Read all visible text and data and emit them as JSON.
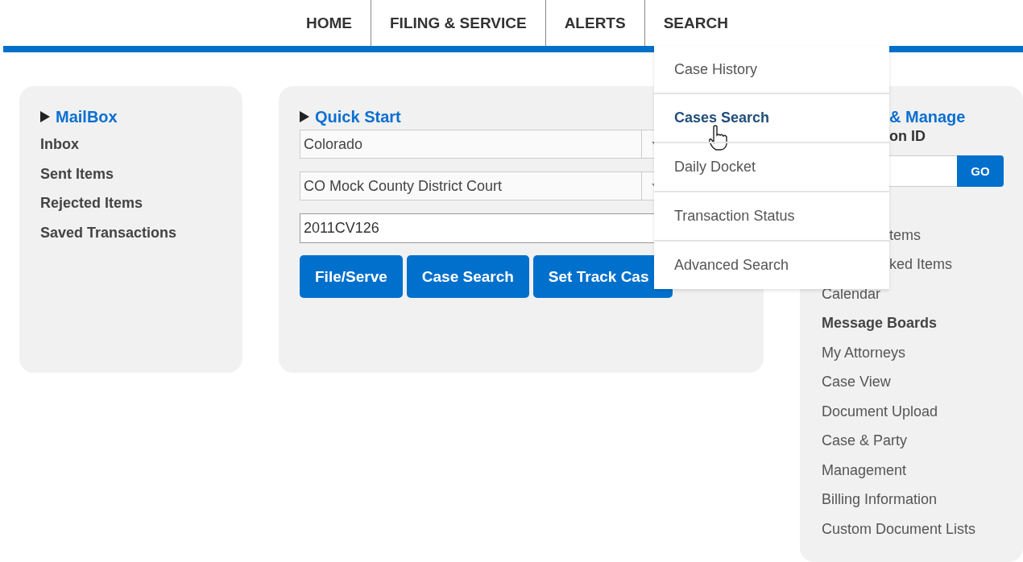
{
  "nav": {
    "tabs": [
      "HOME",
      "FILING & SERVICE",
      "ALERTS",
      "SEARCH"
    ]
  },
  "search_menu": {
    "items": [
      {
        "label": "Case History",
        "selected": false
      },
      {
        "label": "Cases Search",
        "selected": true
      },
      {
        "label": "Daily Docket",
        "selected": false
      },
      {
        "label": "Transaction Status",
        "selected": false
      },
      {
        "label": "Advanced Search",
        "selected": false
      }
    ]
  },
  "mailbox": {
    "title": "MailBox",
    "items": [
      "Inbox",
      "Sent Items",
      "Rejected Items",
      "Saved Transactions"
    ]
  },
  "quick_start": {
    "title": "Quick Start",
    "state_select": {
      "value": "Colorado"
    },
    "court_select": {
      "value": "CO Mock County District Court"
    },
    "case_number": {
      "value": "2011CV126"
    },
    "buttons": [
      "File/Serve",
      "Case Search",
      "Set Track Cas"
    ]
  },
  "right_panel": {
    "title": "& Manage",
    "field_label": "on ID",
    "go_button": "GO",
    "items_partly_hidden": [
      "tems",
      "ked Items"
    ],
    "items": [
      {
        "label": "Calendar",
        "bold": false
      },
      {
        "label": "Message Boards",
        "bold": true
      },
      {
        "label": "My Attorneys",
        "bold": false
      },
      {
        "label": "Case View",
        "bold": false
      },
      {
        "label": "Document Upload",
        "bold": false
      },
      {
        "label": "Case & Party",
        "bold": false
      },
      {
        "label": "Management",
        "bold": false
      },
      {
        "label": "Billing Information",
        "bold": false
      },
      {
        "label": "Custom Document Lists",
        "bold": false
      }
    ]
  }
}
